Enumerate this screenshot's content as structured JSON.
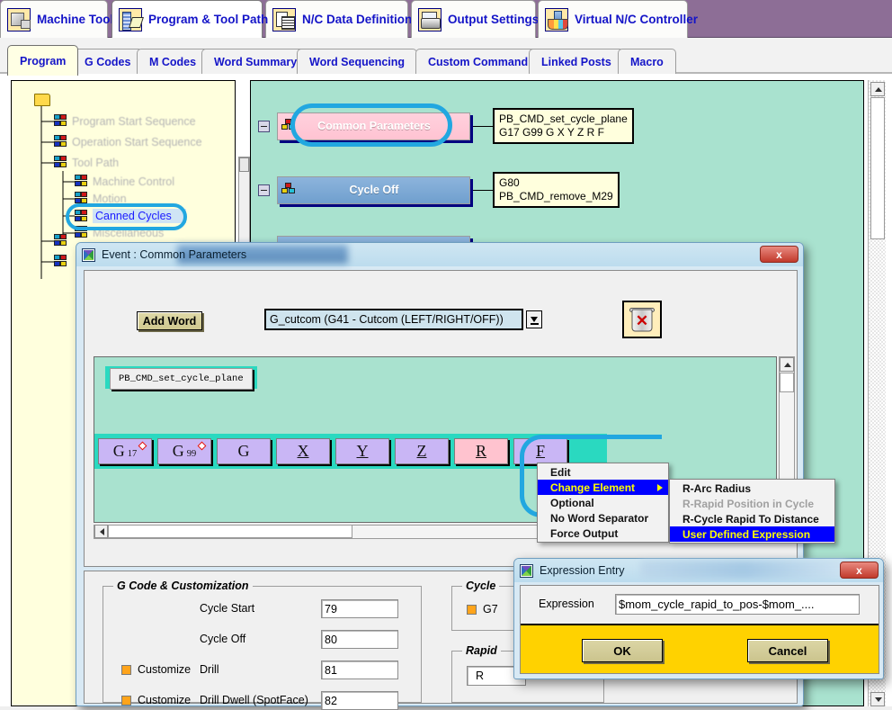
{
  "ribbon": {
    "tabs": [
      {
        "label": "Machine Tool",
        "icon": "machine-tool-icon",
        "active": false
      },
      {
        "label": "Program & Tool Path",
        "icon": "program-tool-path-icon",
        "active": true
      },
      {
        "label": "N/C Data Definitions",
        "icon": "nc-data-definitions-icon",
        "active": false
      },
      {
        "label": "Output Settings",
        "icon": "output-settings-printer-icon",
        "active": false
      },
      {
        "label": "Virtual N/C Controller",
        "icon": "virtual-nc-controller-icon",
        "active": false
      }
    ]
  },
  "subtabs": {
    "items": [
      {
        "label": "Program",
        "active": true
      },
      {
        "label": "G Codes",
        "active": false
      },
      {
        "label": "M Codes",
        "active": false
      },
      {
        "label": "Word Summary",
        "active": false
      },
      {
        "label": "Word Sequencing",
        "active": false
      },
      {
        "label": "Custom Command",
        "active": false
      },
      {
        "label": "Linked Posts",
        "active": false
      },
      {
        "label": "Macro",
        "active": false
      }
    ]
  },
  "tree": {
    "root_icon": "folder-icon",
    "items": [
      {
        "label": "Program Start Sequence",
        "state": "dimmed"
      },
      {
        "label": "Operation Start Sequence",
        "state": "dimmed"
      },
      {
        "label": "Tool Path",
        "state": "dimmed"
      },
      {
        "label": "Machine Control",
        "state": "dimmed"
      },
      {
        "label": "Motion",
        "state": "dimmed"
      },
      {
        "label": "Canned Cycles",
        "state": "selected"
      },
      {
        "label": "Miscellaneous",
        "state": "dimmed"
      }
    ]
  },
  "canvas": {
    "events": [
      {
        "title": "Common Parameters",
        "style": "pink",
        "highlighted": true,
        "code_lines": "PB_CMD_set_cycle_plane\nG17 G99 G X Y Z R F"
      },
      {
        "title": "Cycle Off",
        "style": "blue",
        "highlighted": false,
        "code_lines": "G80\nPB_CMD_remove_M29"
      }
    ]
  },
  "event_dialog": {
    "title": "Event : Common Parameters",
    "close_label": "x",
    "add_word_label": "Add Word",
    "word_combo_value": "G_cutcom (G41 - Cutcom (LEFT/RIGHT/OFF))",
    "delete_icon": "trash-delete-icon",
    "custom_command_button": "PB_CMD_set_cycle_plane",
    "words": [
      {
        "letter": "G",
        "sub": "17",
        "marker": true,
        "underline": false,
        "pink": false
      },
      {
        "letter": "G",
        "sub": "99",
        "marker": true,
        "underline": false,
        "pink": false
      },
      {
        "letter": "G",
        "sub": "",
        "marker": false,
        "underline": false,
        "pink": false
      },
      {
        "letter": "X",
        "sub": "",
        "marker": false,
        "underline": true,
        "pink": false
      },
      {
        "letter": "Y",
        "sub": "",
        "marker": false,
        "underline": true,
        "pink": false
      },
      {
        "letter": "Z",
        "sub": "",
        "marker": false,
        "underline": true,
        "pink": false
      },
      {
        "letter": "R",
        "sub": "",
        "marker": false,
        "underline": true,
        "pink": true
      },
      {
        "letter": "F",
        "sub": "",
        "marker": false,
        "underline": true,
        "pink": false
      }
    ]
  },
  "context_menu": {
    "items": [
      {
        "label": "Edit",
        "state": "normal"
      },
      {
        "label": "Change Element",
        "state": "highlighted",
        "has_submenu": true
      },
      {
        "label": "Optional",
        "state": "normal"
      },
      {
        "label": "No Word Separator",
        "state": "normal"
      },
      {
        "label": "Force Output",
        "state": "normal"
      }
    ],
    "submenu": [
      {
        "label": "R-Arc Radius",
        "state": "normal"
      },
      {
        "label": "R-Rapid Position in Cycle",
        "state": "disabled"
      },
      {
        "label": "R-Cycle Rapid To Distance",
        "state": "normal"
      },
      {
        "label": "User Defined Expression",
        "state": "highlighted"
      }
    ]
  },
  "gcode_panel": {
    "legend": "G Code & Customization",
    "rows": [
      {
        "customize": false,
        "label": "Cycle Start",
        "value": "79"
      },
      {
        "customize": false,
        "label": "Cycle Off",
        "value": "80"
      },
      {
        "customize": true,
        "label": "Drill",
        "value": "81"
      },
      {
        "customize": true,
        "label": "Drill Dwell (SpotFace)",
        "value": "82"
      }
    ]
  },
  "cycle_panel": {
    "legend": "Cycle",
    "option_label": "G7"
  },
  "rapid_panel": {
    "legend": "Rapid",
    "field_label": "R"
  },
  "expression_dialog": {
    "title": "Expression Entry",
    "close_label": "x",
    "field_label": "Expression",
    "field_value": "$mom_cycle_rapid_to_pos-$mom_....",
    "ok_label": "OK",
    "cancel_label": "Cancel"
  },
  "colors": {
    "ribbon_background": "#8d6e96",
    "tab_text": "#1414c8",
    "canvas_background": "#a9e2cf",
    "highlight_ring": "#22a7e0",
    "menu_highlight_bg": "#0000ff",
    "menu_highlight_fg": "#ffff00",
    "expression_panel": "#ffd200",
    "word_button": "#c9b6f5",
    "word_button_selected": "#ffc3cf"
  }
}
